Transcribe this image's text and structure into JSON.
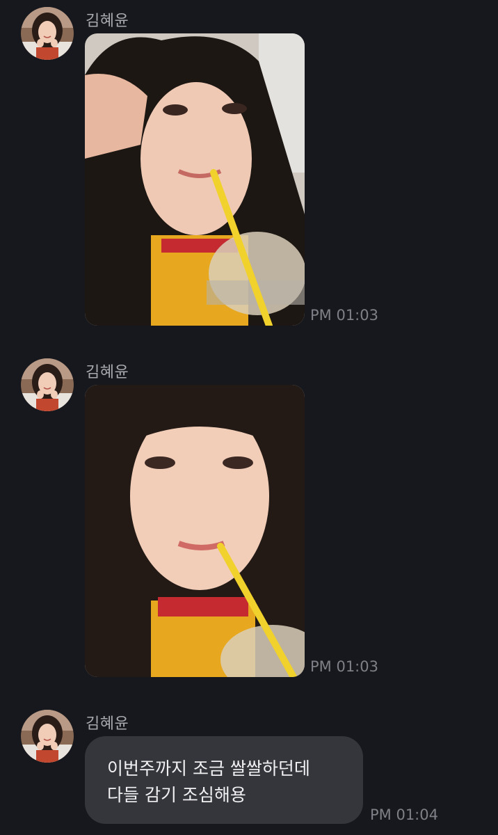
{
  "chat": {
    "messages": [
      {
        "sender": "김혜윤",
        "type": "photo",
        "avatar_icon": "profile-avatar",
        "image_icon": "selfie-with-drink-straw",
        "time": "PM 01:03"
      },
      {
        "sender": "김혜윤",
        "type": "photo",
        "avatar_icon": "profile-avatar",
        "image_icon": "selfie-closeup-with-straw",
        "time": "PM 01:03"
      },
      {
        "sender": "김혜윤",
        "type": "text",
        "avatar_icon": "profile-avatar",
        "lines": [
          "이번주까지 조금 쌀쌀하던데",
          "다들 감기 조심해용"
        ],
        "time": "PM 01:04"
      }
    ]
  },
  "colors": {
    "background": "#17181d",
    "bubble": "#35363c",
    "sender_text": "#a9aab0",
    "timestamp_text": "#7f8087"
  }
}
